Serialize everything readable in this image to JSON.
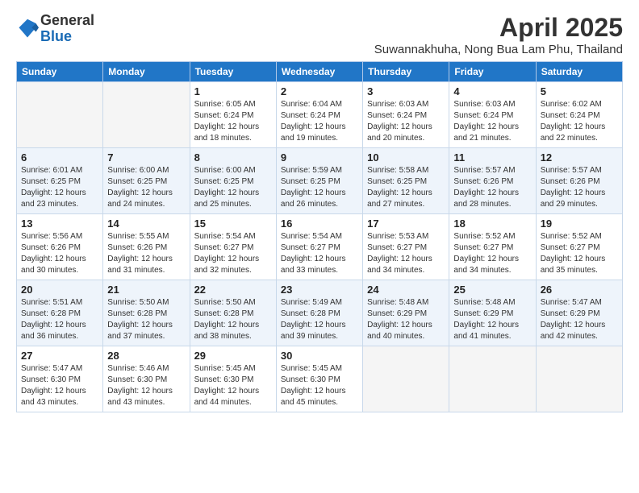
{
  "logo": {
    "general": "General",
    "blue": "Blue"
  },
  "title": "April 2025",
  "location": "Suwannakhuha, Nong Bua Lam Phu, Thailand",
  "weekdays": [
    "Sunday",
    "Monday",
    "Tuesday",
    "Wednesday",
    "Thursday",
    "Friday",
    "Saturday"
  ],
  "weeks": [
    [
      {
        "day": null,
        "sunrise": null,
        "sunset": null,
        "daylight": null
      },
      {
        "day": null,
        "sunrise": null,
        "sunset": null,
        "daylight": null
      },
      {
        "day": "1",
        "sunrise": "Sunrise: 6:05 AM",
        "sunset": "Sunset: 6:24 PM",
        "daylight": "Daylight: 12 hours and 18 minutes."
      },
      {
        "day": "2",
        "sunrise": "Sunrise: 6:04 AM",
        "sunset": "Sunset: 6:24 PM",
        "daylight": "Daylight: 12 hours and 19 minutes."
      },
      {
        "day": "3",
        "sunrise": "Sunrise: 6:03 AM",
        "sunset": "Sunset: 6:24 PM",
        "daylight": "Daylight: 12 hours and 20 minutes."
      },
      {
        "day": "4",
        "sunrise": "Sunrise: 6:03 AM",
        "sunset": "Sunset: 6:24 PM",
        "daylight": "Daylight: 12 hours and 21 minutes."
      },
      {
        "day": "5",
        "sunrise": "Sunrise: 6:02 AM",
        "sunset": "Sunset: 6:24 PM",
        "daylight": "Daylight: 12 hours and 22 minutes."
      }
    ],
    [
      {
        "day": "6",
        "sunrise": "Sunrise: 6:01 AM",
        "sunset": "Sunset: 6:25 PM",
        "daylight": "Daylight: 12 hours and 23 minutes."
      },
      {
        "day": "7",
        "sunrise": "Sunrise: 6:00 AM",
        "sunset": "Sunset: 6:25 PM",
        "daylight": "Daylight: 12 hours and 24 minutes."
      },
      {
        "day": "8",
        "sunrise": "Sunrise: 6:00 AM",
        "sunset": "Sunset: 6:25 PM",
        "daylight": "Daylight: 12 hours and 25 minutes."
      },
      {
        "day": "9",
        "sunrise": "Sunrise: 5:59 AM",
        "sunset": "Sunset: 6:25 PM",
        "daylight": "Daylight: 12 hours and 26 minutes."
      },
      {
        "day": "10",
        "sunrise": "Sunrise: 5:58 AM",
        "sunset": "Sunset: 6:25 PM",
        "daylight": "Daylight: 12 hours and 27 minutes."
      },
      {
        "day": "11",
        "sunrise": "Sunrise: 5:57 AM",
        "sunset": "Sunset: 6:26 PM",
        "daylight": "Daylight: 12 hours and 28 minutes."
      },
      {
        "day": "12",
        "sunrise": "Sunrise: 5:57 AM",
        "sunset": "Sunset: 6:26 PM",
        "daylight": "Daylight: 12 hours and 29 minutes."
      }
    ],
    [
      {
        "day": "13",
        "sunrise": "Sunrise: 5:56 AM",
        "sunset": "Sunset: 6:26 PM",
        "daylight": "Daylight: 12 hours and 30 minutes."
      },
      {
        "day": "14",
        "sunrise": "Sunrise: 5:55 AM",
        "sunset": "Sunset: 6:26 PM",
        "daylight": "Daylight: 12 hours and 31 minutes."
      },
      {
        "day": "15",
        "sunrise": "Sunrise: 5:54 AM",
        "sunset": "Sunset: 6:27 PM",
        "daylight": "Daylight: 12 hours and 32 minutes."
      },
      {
        "day": "16",
        "sunrise": "Sunrise: 5:54 AM",
        "sunset": "Sunset: 6:27 PM",
        "daylight": "Daylight: 12 hours and 33 minutes."
      },
      {
        "day": "17",
        "sunrise": "Sunrise: 5:53 AM",
        "sunset": "Sunset: 6:27 PM",
        "daylight": "Daylight: 12 hours and 34 minutes."
      },
      {
        "day": "18",
        "sunrise": "Sunrise: 5:52 AM",
        "sunset": "Sunset: 6:27 PM",
        "daylight": "Daylight: 12 hours and 34 minutes."
      },
      {
        "day": "19",
        "sunrise": "Sunrise: 5:52 AM",
        "sunset": "Sunset: 6:27 PM",
        "daylight": "Daylight: 12 hours and 35 minutes."
      }
    ],
    [
      {
        "day": "20",
        "sunrise": "Sunrise: 5:51 AM",
        "sunset": "Sunset: 6:28 PM",
        "daylight": "Daylight: 12 hours and 36 minutes."
      },
      {
        "day": "21",
        "sunrise": "Sunrise: 5:50 AM",
        "sunset": "Sunset: 6:28 PM",
        "daylight": "Daylight: 12 hours and 37 minutes."
      },
      {
        "day": "22",
        "sunrise": "Sunrise: 5:50 AM",
        "sunset": "Sunset: 6:28 PM",
        "daylight": "Daylight: 12 hours and 38 minutes."
      },
      {
        "day": "23",
        "sunrise": "Sunrise: 5:49 AM",
        "sunset": "Sunset: 6:28 PM",
        "daylight": "Daylight: 12 hours and 39 minutes."
      },
      {
        "day": "24",
        "sunrise": "Sunrise: 5:48 AM",
        "sunset": "Sunset: 6:29 PM",
        "daylight": "Daylight: 12 hours and 40 minutes."
      },
      {
        "day": "25",
        "sunrise": "Sunrise: 5:48 AM",
        "sunset": "Sunset: 6:29 PM",
        "daylight": "Daylight: 12 hours and 41 minutes."
      },
      {
        "day": "26",
        "sunrise": "Sunrise: 5:47 AM",
        "sunset": "Sunset: 6:29 PM",
        "daylight": "Daylight: 12 hours and 42 minutes."
      }
    ],
    [
      {
        "day": "27",
        "sunrise": "Sunrise: 5:47 AM",
        "sunset": "Sunset: 6:30 PM",
        "daylight": "Daylight: 12 hours and 43 minutes."
      },
      {
        "day": "28",
        "sunrise": "Sunrise: 5:46 AM",
        "sunset": "Sunset: 6:30 PM",
        "daylight": "Daylight: 12 hours and 43 minutes."
      },
      {
        "day": "29",
        "sunrise": "Sunrise: 5:45 AM",
        "sunset": "Sunset: 6:30 PM",
        "daylight": "Daylight: 12 hours and 44 minutes."
      },
      {
        "day": "30",
        "sunrise": "Sunrise: 5:45 AM",
        "sunset": "Sunset: 6:30 PM",
        "daylight": "Daylight: 12 hours and 45 minutes."
      },
      {
        "day": null,
        "sunrise": null,
        "sunset": null,
        "daylight": null
      },
      {
        "day": null,
        "sunrise": null,
        "sunset": null,
        "daylight": null
      },
      {
        "day": null,
        "sunrise": null,
        "sunset": null,
        "daylight": null
      }
    ]
  ]
}
